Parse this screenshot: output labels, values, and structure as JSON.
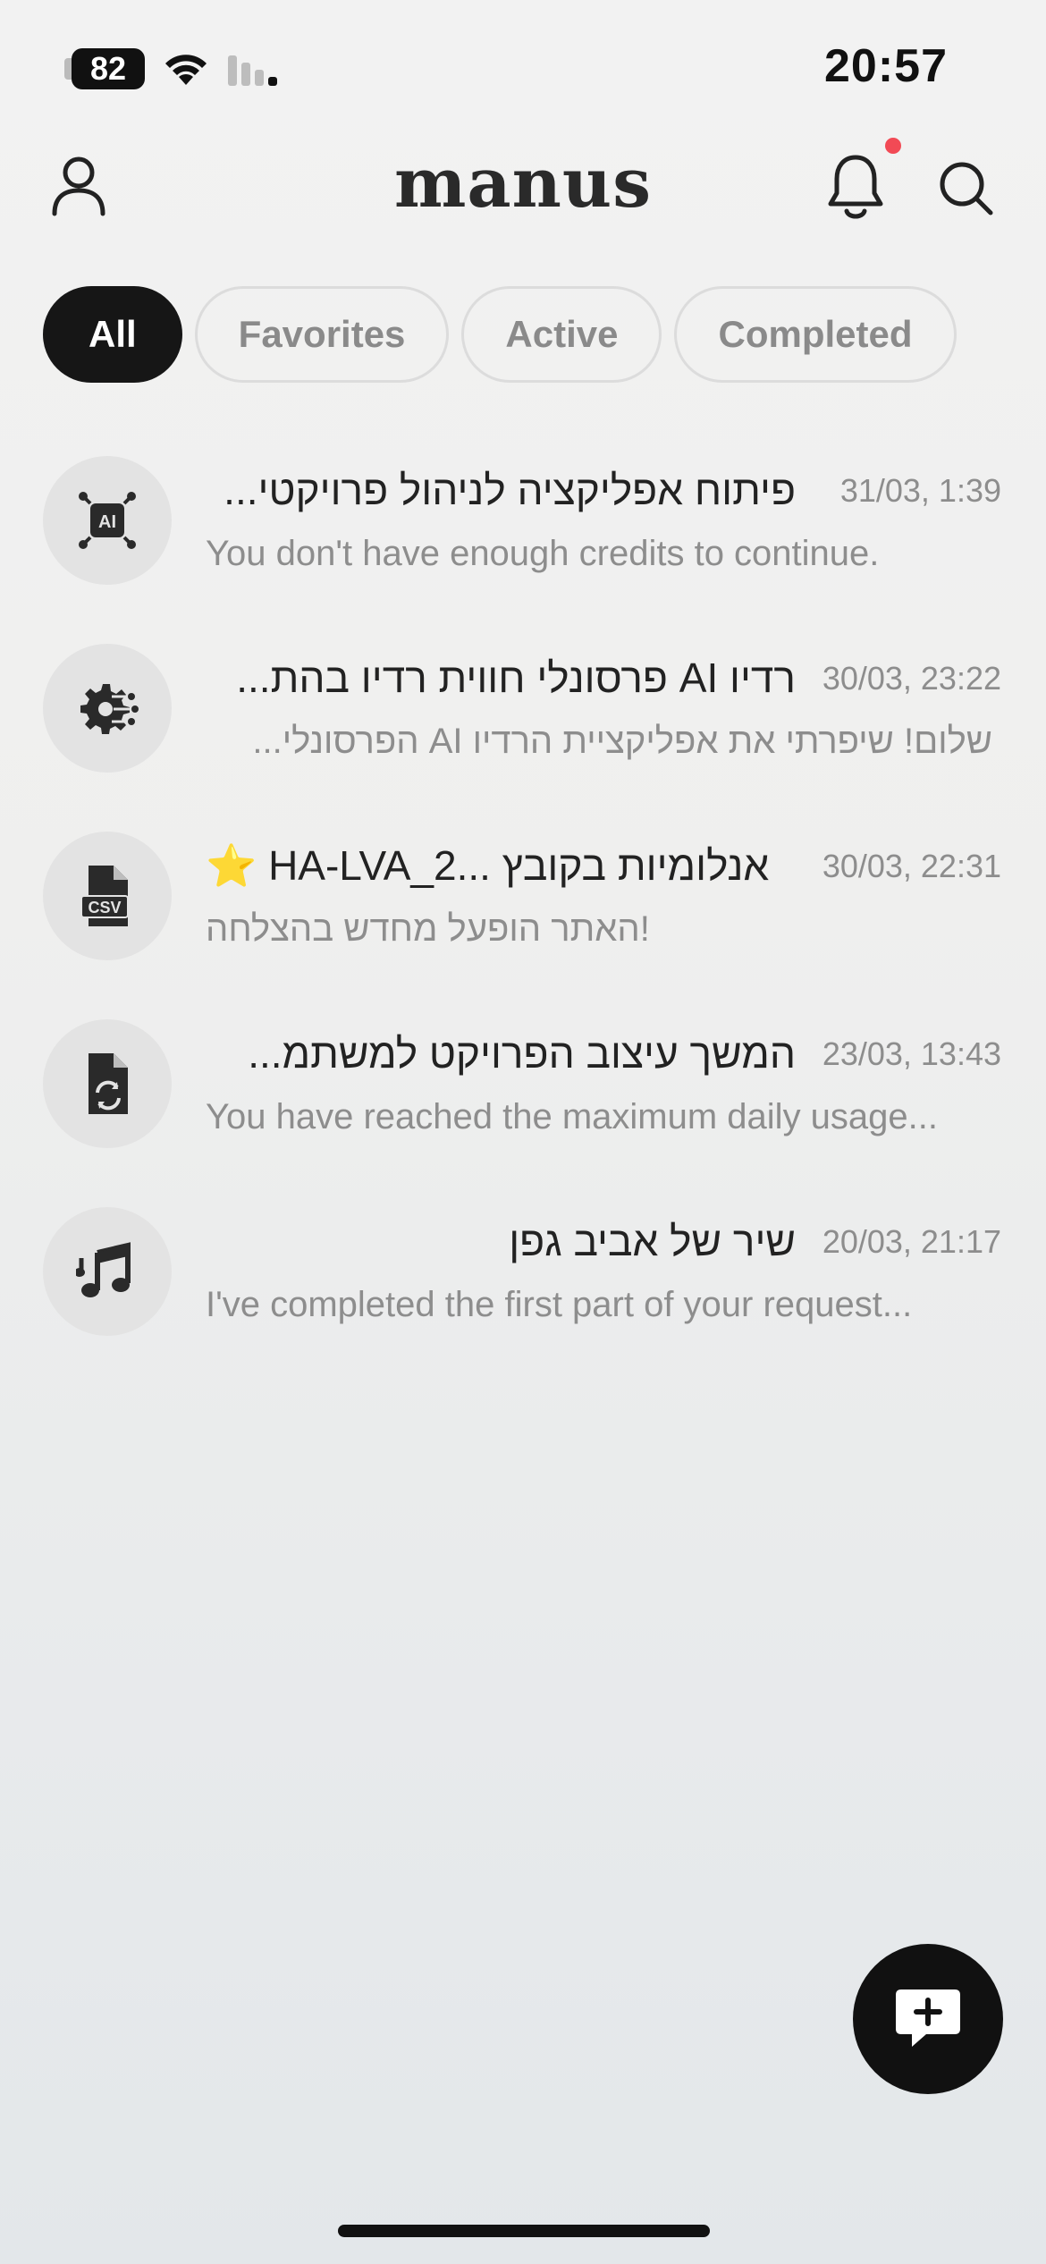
{
  "status_bar": {
    "time": "20:57",
    "battery": "82"
  },
  "header": {
    "logo": "manus"
  },
  "tabs": [
    {
      "label": "All",
      "active": true
    },
    {
      "label": "Favorites",
      "active": false
    },
    {
      "label": "Active",
      "active": false
    },
    {
      "label": "Completed",
      "active": false
    }
  ],
  "tasks": [
    {
      "icon": "ai-chip-icon",
      "title": "פיתוח אפליקציה לניהול פרויקטי...",
      "timestamp": "31/03, 1:39",
      "subtitle": "You don't have enough credits to continue."
    },
    {
      "icon": "gear-nodes-icon",
      "title": "רדיו AI פרסונלי חווית רדיו בהת...",
      "timestamp": "30/03, 23:22",
      "subtitle": "שלום! שיפרתי את אפליקציית הרדיו AI הפרסונלי..."
    },
    {
      "icon": "csv-file-icon",
      "favorite": true,
      "star": "⭐",
      "title": "HA-LVA_2... אנלומיות בקובץ",
      "timestamp": "30/03, 22:31",
      "subtitle": "האתר הופעל מחדש בהצלחה!"
    },
    {
      "icon": "file-sync-icon",
      "title": "המשך עיצוב הפרויקט למשתמ...",
      "timestamp": "23/03, 13:43",
      "subtitle": "You have reached the maximum daily usage..."
    },
    {
      "icon": "music-note-icon",
      "title": "שיר של אביב גפן",
      "timestamp": "20/03, 21:17",
      "subtitle": "I've completed the first part of your request..."
    }
  ],
  "colors": {
    "accent_dark": "#161616",
    "notification_dot": "#f24a55",
    "star": "#f5b82e",
    "muted_text": "#8d8d8d"
  }
}
